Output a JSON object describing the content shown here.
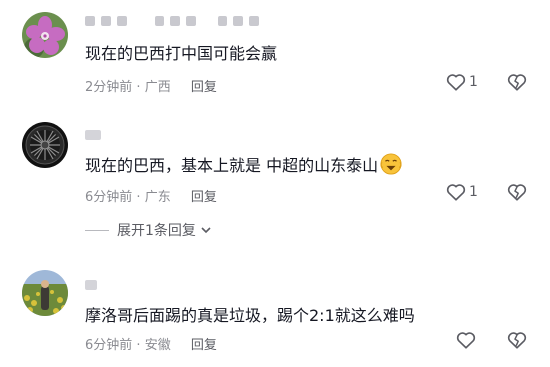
{
  "comments": [
    {
      "text": "现在的巴西打中国可能会赢",
      "time": "2分钟前",
      "location": "广西",
      "reply_label": "回复",
      "like_count": "1"
    },
    {
      "text": "现在的巴西，基本上就是  中超的山东泰山",
      "time": "6分钟前",
      "location": "广东",
      "reply_label": "回复",
      "like_count": "1",
      "expand_label": "展开1条回复"
    },
    {
      "text": "摩洛哥后面踢的真是垃圾，踢个2:1就这么难吗",
      "time": "6分钟前",
      "location": "安徽",
      "reply_label": "回复",
      "like_count": ""
    }
  ],
  "meta_separator": " · ",
  "icons": [
    "heart-icon",
    "broken-heart-icon",
    "chevron-down-icon",
    "emoji-icon"
  ],
  "colors": {
    "text": "#161823",
    "meta": "#8a8b91",
    "icon": "#5b5c63"
  }
}
